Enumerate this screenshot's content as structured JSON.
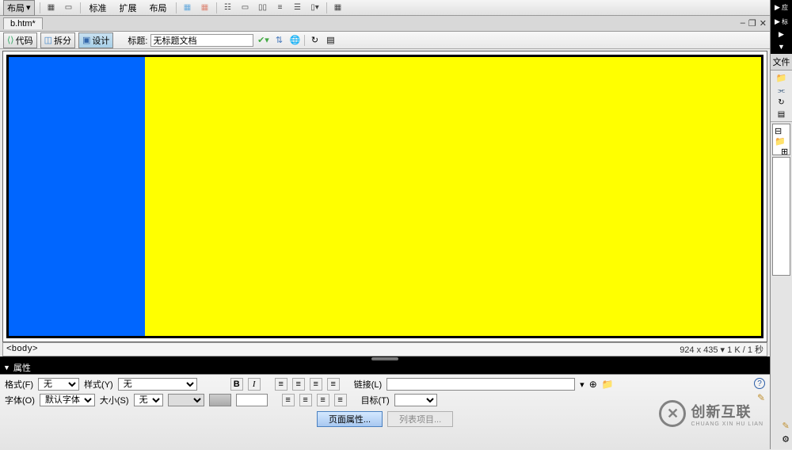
{
  "top_toolbar": {
    "layout_menu": "布局",
    "buttons": [
      "标准",
      "扩展",
      "布局"
    ]
  },
  "tab": {
    "filename": "b.htm*",
    "minimize": "–",
    "restore": "❐",
    "close": "✕"
  },
  "doc_toolbar": {
    "code": "代码",
    "split": "拆分",
    "design": "设计",
    "title_label": "标题:",
    "title_value": "无标题文档"
  },
  "tag_selector": "<body>",
  "status": "924 x 435 ▾ 1 K / 1 秒",
  "properties": {
    "header": "属性",
    "format_label": "格式(F)",
    "format_value": "无",
    "style_label": "样式(Y)",
    "style_value": "无",
    "font_label": "字体(O)",
    "font_value": "默认字体",
    "size_label": "大小(S)",
    "size_value": "无",
    "link_label": "链接(L)",
    "target_label": "目标(T)",
    "page_props": "页面属性...",
    "list_item": "列表项目..."
  },
  "right": {
    "files_label": "文件"
  },
  "watermark": {
    "cn": "创新互联",
    "en": "CHUANG XIN HU LIAN"
  }
}
